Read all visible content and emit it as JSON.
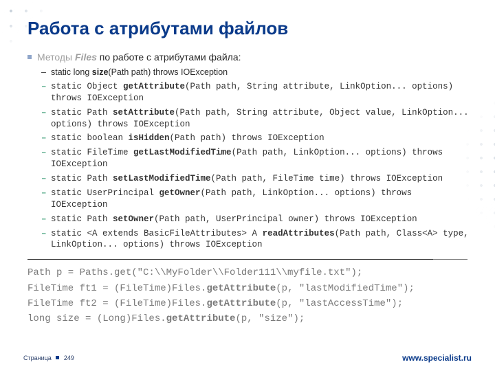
{
  "title": "Работа с атрибутами файлов",
  "lead_pre": "Методы ",
  "lead_em": "Files",
  "lead_post": " по работе с атрибутами файла:",
  "m0_a": "static long ",
  "m0_b": "size",
  "m0_c": "(Path path) throws IOException",
  "m1_a": "static Object ",
  "m1_b": "getAttribute",
  "m1_c": "(Path path, String attribute, LinkOption... options) throws IOException",
  "m2_a": "static Path ",
  "m2_b": "setAttribute",
  "m2_c": "(Path path, String attribute, Object value, LinkOption... options) throws IOException",
  "m3_a": "static boolean ",
  "m3_b": "isHidden",
  "m3_c": "(Path path) throws IOException",
  "m4_a": "static FileTime ",
  "m4_b": "getLastModifiedTime",
  "m4_c": "(Path path, LinkOption... options) throws IOException",
  "m5_a": "static Path ",
  "m5_b": "setLastModifiedTime",
  "m5_c": "(Path path, FileTime time) throws IOException",
  "m6_a": "static UserPrincipal ",
  "m6_b": "getOwner",
  "m6_c": "(Path path, LinkOption... options) throws IOException",
  "m7_a": "static Path ",
  "m7_b": "setOwner",
  "m7_c": "(Path path, UserPrincipal owner) throws IOException",
  "m8_a": "static <A extends BasicFileAttributes> A ",
  "m8_b": "readAttributes",
  "m8_c": "(Path path, Class<A> type, LinkOption... options) throws IOException",
  "s0_a": "Path p = Paths.get(\"C:\\\\MyFolder\\\\Folder111\\\\myfile.txt\");",
  "s1_a": "FileTime ft1 = (FileTime)Files.",
  "s1_b": "getAttribute",
  "s1_c": "(p, \"lastModifiedTime\");",
  "s2_a": "FileTime ft2 = (FileTime)Files.",
  "s2_b": "getAttribute",
  "s2_c": "(p, \"lastAccessTime\");",
  "s3_a": "long size = (Long)Files.",
  "s3_b": "getAttribute",
  "s3_c": "(p, \"size\");",
  "footer_label": "Страница",
  "footer_num": "249",
  "footer_url": "www.specialist.ru"
}
